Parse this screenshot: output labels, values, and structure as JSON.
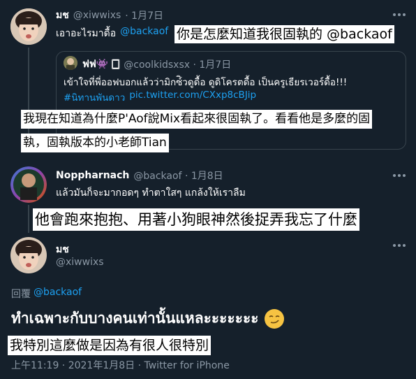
{
  "tweet1": {
    "name": "มช",
    "handle": "@xiwwixs",
    "date": "· 1月7日",
    "text": "เอาอะไรมาดื้อ",
    "mention": "@backaof",
    "caption": "你是怎麼知道我很固執的 @backaof",
    "quote": {
      "name": "ฟฟ👾 🀆",
      "handle": "@coolkidsxsx · 1月7日",
      "line1": "เข้าใจที่พี่ออฟบอกแล้วว่ามิกซ์ิวดูดื้อ ดูดิโครตดื้อ เป็นครูเธียรเวอร์ดื้อ!!!",
      "hashtag": "#นิทานพันดาว",
      "link": "pic.twitter.com/CXxp8cBJip",
      "caption_line1": "我現在知道為什麼P'Aof說Mix看起來很固執了。看看他是多麼的固",
      "caption_line2": "執，固執版本的小老師Tian"
    }
  },
  "tweet2": {
    "name": "Noppharnach",
    "handle": "@backaof · 1月8日",
    "text": "แล้วมันก็จะมากอดๆ ทำตาใสๆ แกล้งให้เราลืม",
    "caption": "他會跑來抱抱、用著小狗眼神然後捉弄我忘了什麼"
  },
  "main": {
    "name": "มช",
    "handle": "@xiwwixs",
    "reply_label": "回覆",
    "reply_to": "@backaof",
    "text": "ทำเฉพาะกับบางคนเท่านั้นแหละะะะะะะ",
    "emoji": "😏",
    "caption": "我特別這麼做是因為有很人很特別",
    "meta": "上午11:19 · 2021年1月8日 · Twitter for iPhone"
  }
}
